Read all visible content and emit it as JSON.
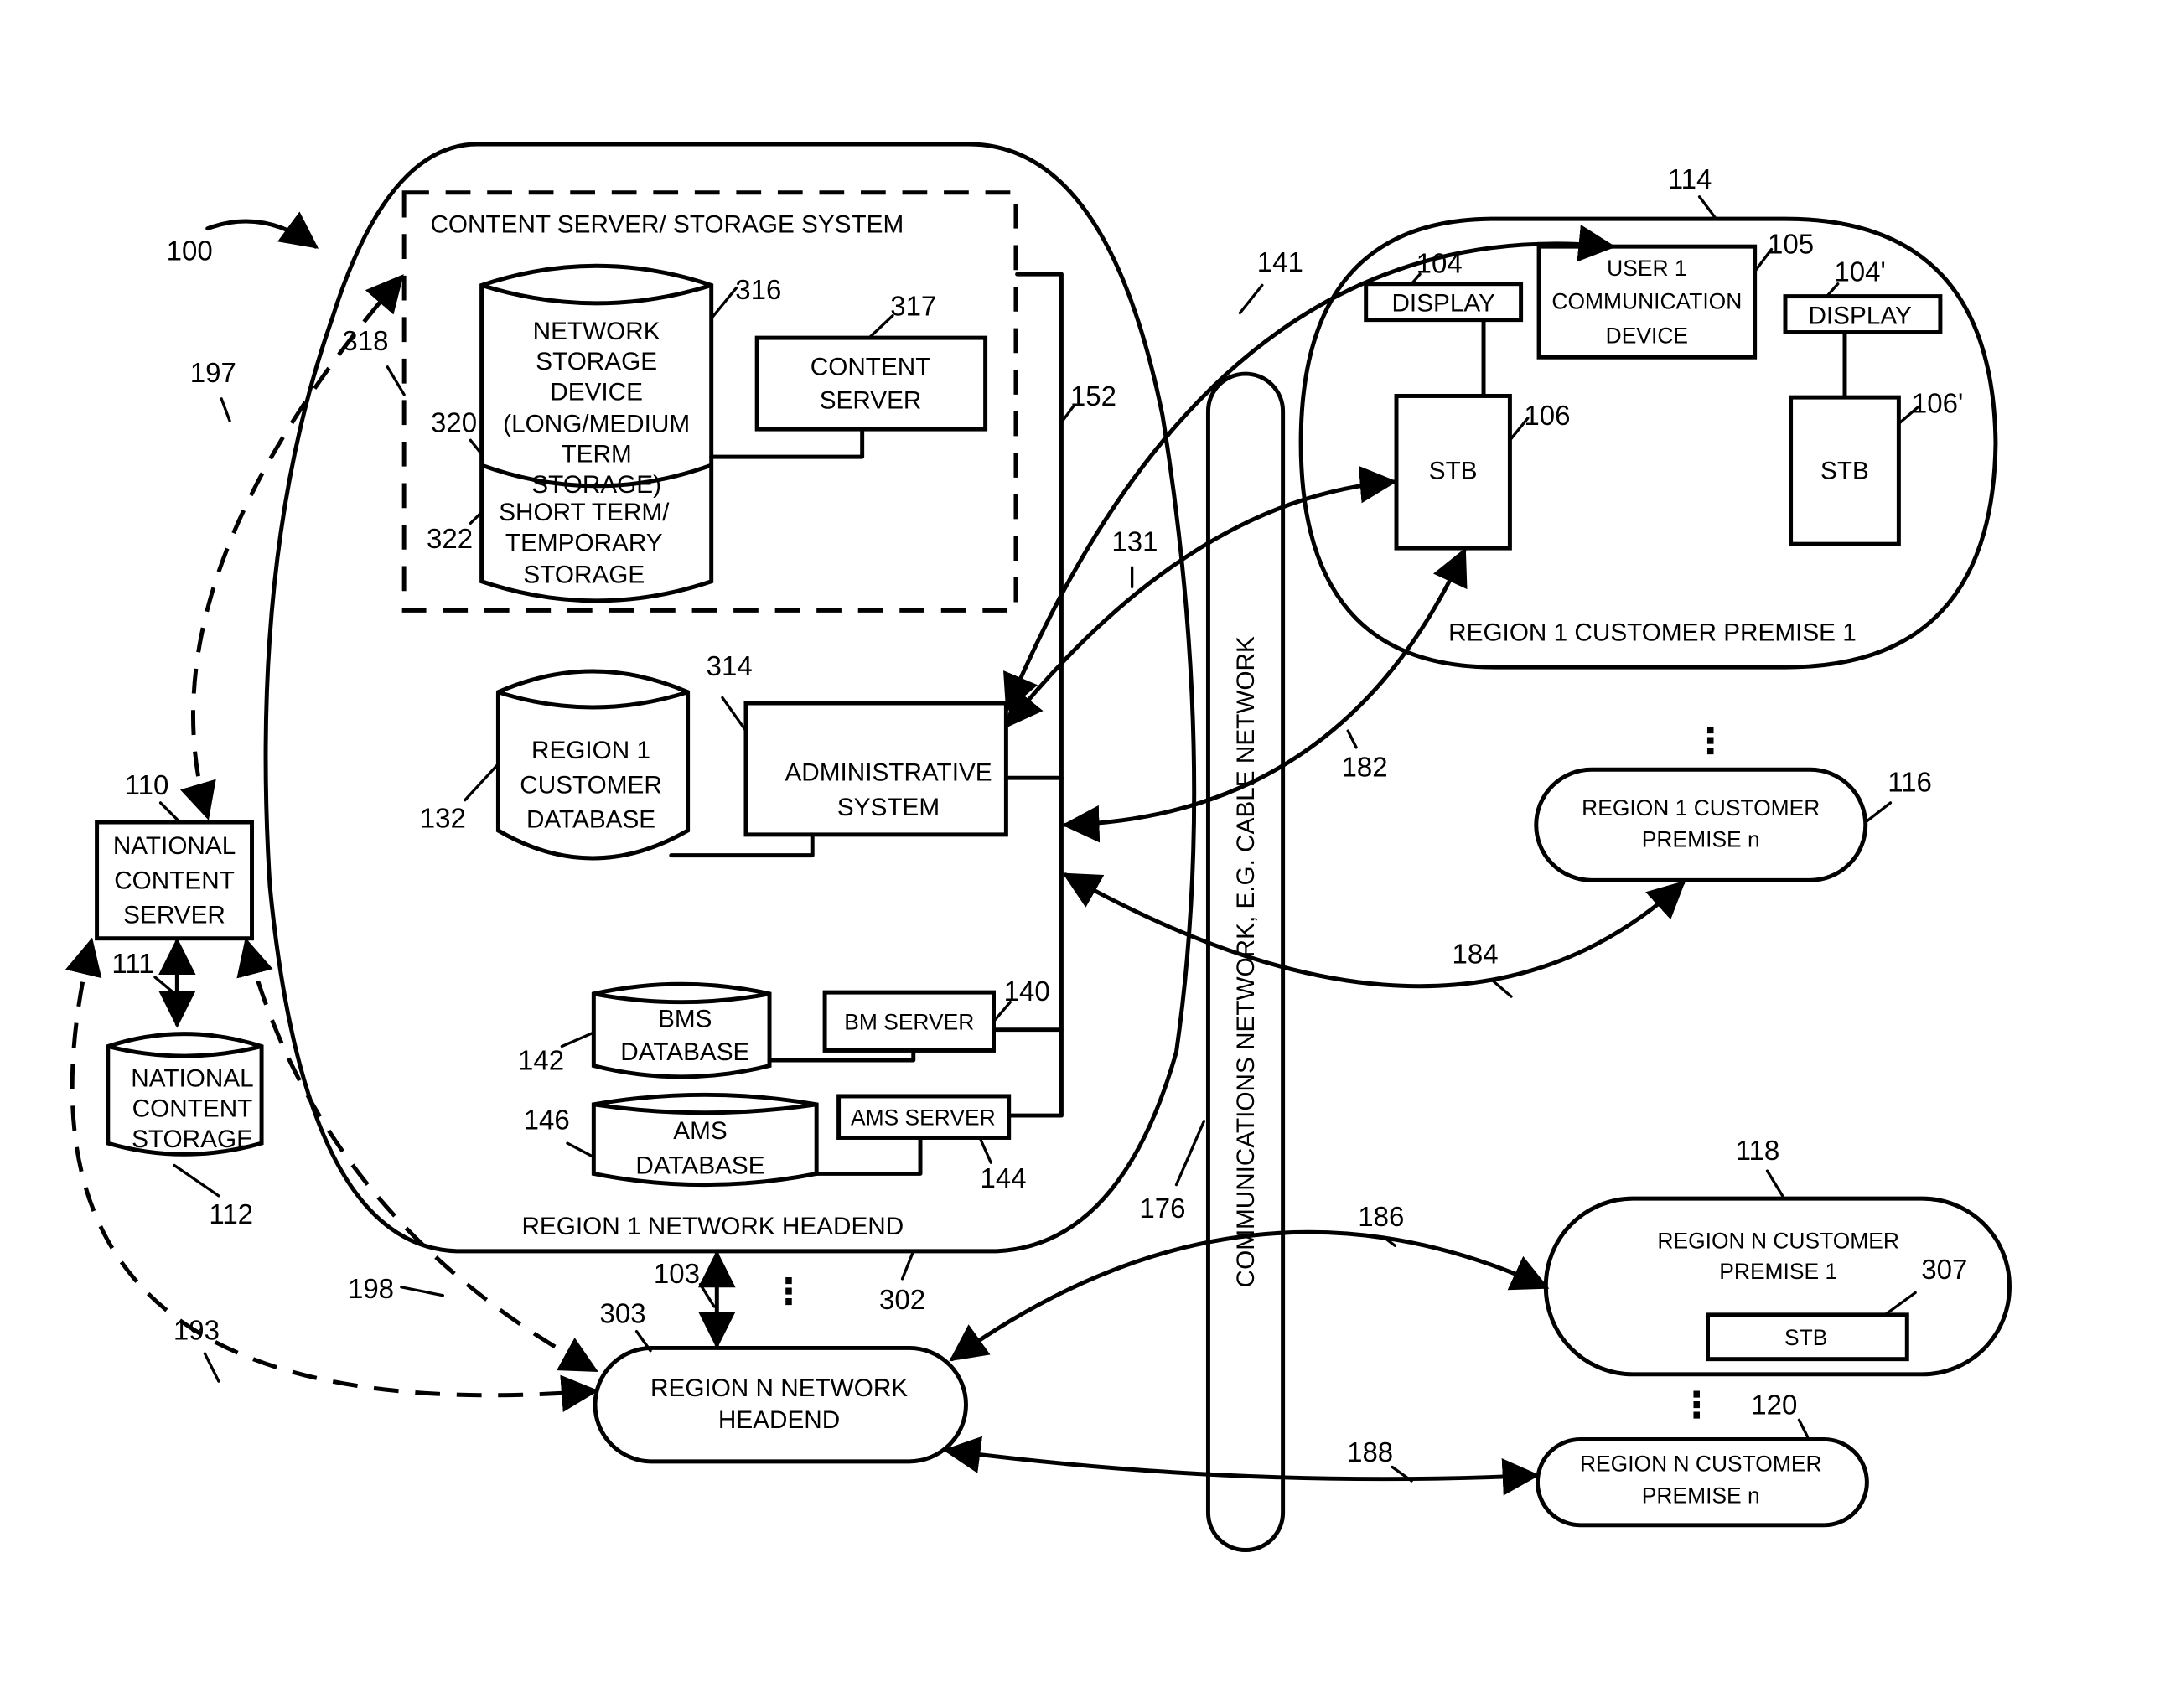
{
  "figure": {
    "system_ref": "100",
    "region1_headend": {
      "label": "REGION 1 NETWORK HEADEND",
      "ref": "302",
      "content_server_storage_system": {
        "label": "CONTENT SERVER/ STORAGE SYSTEM",
        "ref": "318",
        "network_storage_device": {
          "lines": [
            "NETWORK",
            "STORAGE",
            "DEVICE",
            "(LONG/MEDIUM",
            "TERM",
            "STORAGE)"
          ],
          "ref": "316",
          "long_term_ref": "320"
        },
        "short_term_storage": {
          "lines": [
            "SHORT TERM/",
            "TEMPORARY",
            "STORAGE"
          ],
          "ref": "322"
        },
        "content_server": {
          "lines": [
            "CONTENT",
            "SERVER"
          ],
          "ref": "317"
        }
      },
      "bus_ref": "152",
      "customer_database": {
        "lines": [
          "REGION 1",
          "CUSTOMER",
          "DATABASE"
        ],
        "ref": "132"
      },
      "administrative_system": {
        "lines": [
          "ADMINISTRATIVE",
          "SYSTEM"
        ],
        "ref": "314"
      },
      "bms_database": {
        "lines": [
          "BMS",
          "DATABASE"
        ],
        "ref": "142"
      },
      "bm_server": {
        "label": "BM SERVER",
        "ref": "140"
      },
      "ams_database": {
        "lines": [
          "AMS",
          "DATABASE"
        ],
        "ref": "146"
      },
      "ams_server": {
        "label": "AMS SERVER",
        "ref": "144"
      }
    },
    "national_content_server": {
      "lines": [
        "NATIONAL",
        "CONTENT",
        "SERVER"
      ],
      "ref": "110"
    },
    "national_content_storage": {
      "lines": [
        "NATIONAL",
        "CONTENT",
        "STORAGE"
      ],
      "ref": "112"
    },
    "national_link_ref": "111",
    "region_n_headend": {
      "lines": [
        "REGION N NETWORK",
        "HEADEND"
      ],
      "ref": "303"
    },
    "headend_link_ref": "103",
    "communications_network": {
      "label": "COMMUNICATIONS NETWORK, E.G. CABLE NETWORK",
      "ref": "176"
    },
    "region1_premise1": {
      "label": "REGION 1 CUSTOMER PREMISE 1",
      "ref": "114",
      "display_a": {
        "label": "DISPLAY",
        "ref": "104"
      },
      "display_b": {
        "label": "DISPLAY",
        "ref": "104'"
      },
      "comm_device": {
        "lines": [
          "USER 1",
          "COMMUNICATION",
          "DEVICE"
        ],
        "ref": "105"
      },
      "stb_a": {
        "label": "STB",
        "ref": "106"
      },
      "stb_b": {
        "label": "STB",
        "ref": "106'"
      }
    },
    "region1_premise_n": {
      "lines": [
        "REGION 1 CUSTOMER",
        "PREMISE n"
      ],
      "ref": "116"
    },
    "regionN_premise1": {
      "lines": [
        "REGION N CUSTOMER",
        "PREMISE 1"
      ],
      "ref": "118",
      "stb": {
        "label": "STB",
        "ref": "307"
      }
    },
    "regionN_premise_n": {
      "lines": [
        "REGION N CUSTOMER",
        "PREMISE n"
      ],
      "ref": "120"
    },
    "links": {
      "l141": "141",
      "l131": "131",
      "l182": "182",
      "l184": "184",
      "l186": "186",
      "l188": "188",
      "l193": "193",
      "l197": "197",
      "l198": "198"
    },
    "ellipsis": "⋮"
  }
}
